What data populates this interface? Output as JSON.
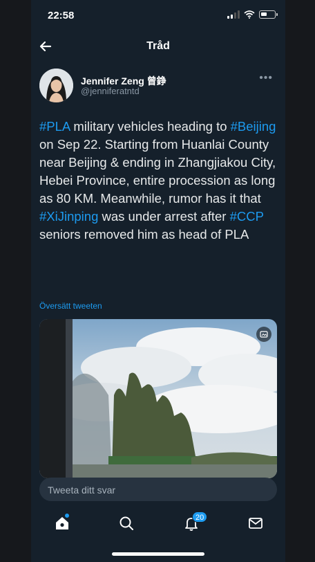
{
  "status_bar": {
    "time": "22:58"
  },
  "header": {
    "title": "Tråd"
  },
  "author": {
    "display_name": "Jennifer Zeng 曾錚",
    "handle": "@jenniferatntd"
  },
  "tweet": {
    "tag_pla": "#PLA",
    "text_1": " military vehicles heading to ",
    "tag_beijing": "#Beijing",
    "text_2": " on Sep 22. Starting from Huanlai County near Beijing & ending in Zhangjiakou City, Hebei Province, entire procession as long as 80 KM. Meanwhile, rumor has it that ",
    "tag_xijinping": "#XiJinping",
    "text_3": " was under arrest after ",
    "tag_ccp": "#CCP",
    "text_4": " seniors removed him as head of PLA"
  },
  "translate_label": "Översätt tweeten",
  "reply": {
    "placeholder": "Tweeta ditt svar"
  },
  "tabbar": {
    "notifications_count": "20"
  }
}
